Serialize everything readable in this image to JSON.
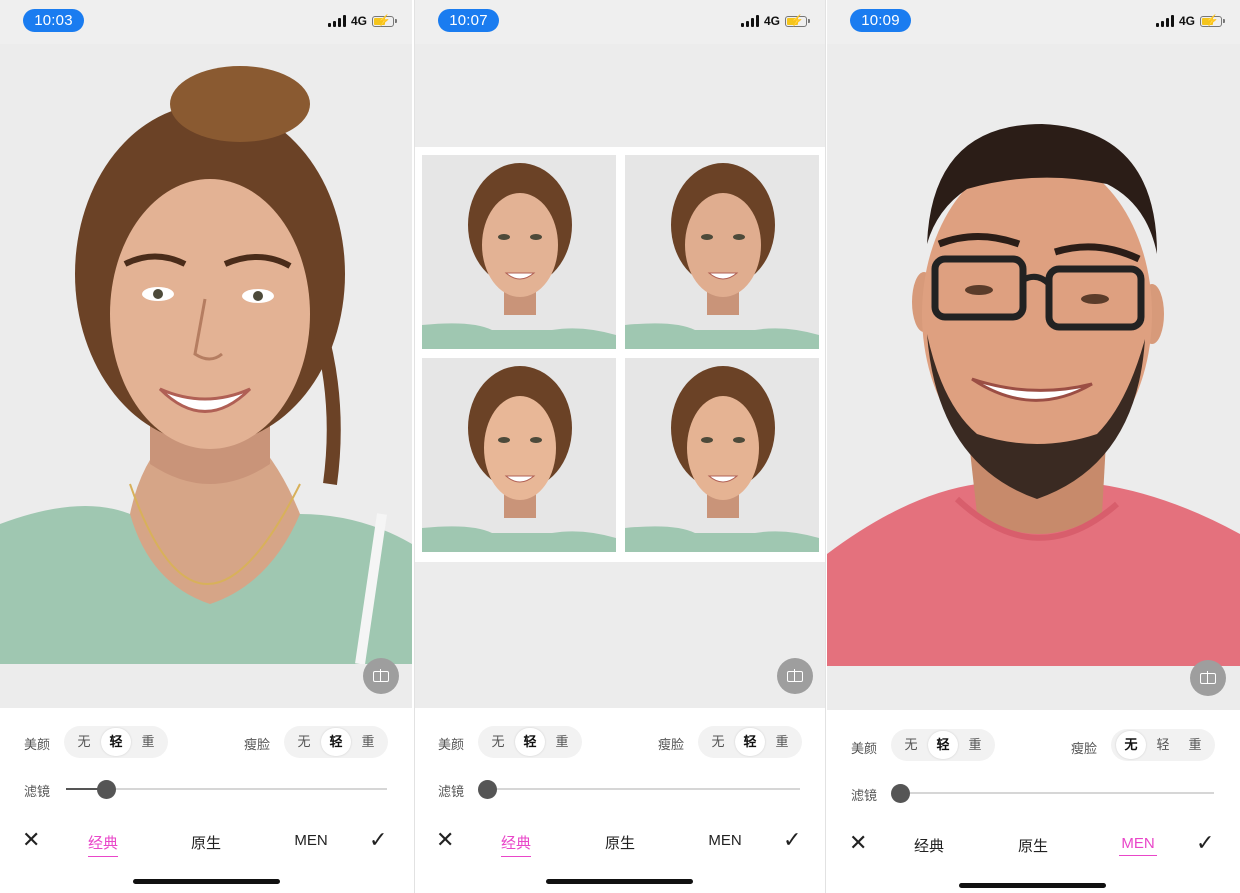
{
  "screens": [
    {
      "status": {
        "time": "10:03",
        "network": "4G"
      },
      "controls": {
        "beauty_label": "美颜",
        "beauty_options": [
          "无",
          "轻",
          "重"
        ],
        "beauty_selected": "轻",
        "slim_label": "瘦脸",
        "slim_options": [
          "无",
          "轻",
          "重"
        ],
        "slim_selected": "轻",
        "filter_label": "滤镜",
        "filter_level": 0.14
      },
      "tabs": [
        "经典",
        "原生",
        "MEN"
      ],
      "selected_tab": "经典"
    },
    {
      "status": {
        "time": "10:07",
        "network": "4G"
      },
      "controls": {
        "beauty_label": "美颜",
        "beauty_options": [
          "无",
          "轻",
          "重"
        ],
        "beauty_selected": "轻",
        "slim_label": "瘦脸",
        "slim_options": [
          "无",
          "轻",
          "重"
        ],
        "slim_selected": "轻",
        "filter_label": "滤镜",
        "filter_level": 0.0
      },
      "tabs": [
        "经典",
        "原生",
        "MEN"
      ],
      "selected_tab": "经典"
    },
    {
      "status": {
        "time": "10:09",
        "network": "4G"
      },
      "controls": {
        "beauty_label": "美颜",
        "beauty_options": [
          "无",
          "轻",
          "重"
        ],
        "beauty_selected": "轻",
        "slim_label": "瘦脸",
        "slim_options": [
          "无",
          "轻",
          "重"
        ],
        "slim_selected": "无",
        "filter_label": "滤镜",
        "filter_level": 0.0
      },
      "tabs": [
        "经典",
        "原生",
        "MEN"
      ],
      "selected_tab": "MEN"
    }
  ],
  "icons": {
    "close": "close-icon",
    "confirm": "check-icon",
    "compare": "compare-icon",
    "signal": "signal-icon",
    "battery": "battery-charging-icon"
  },
  "colors": {
    "time_pill": "#1a7cf0",
    "accent_tab": "#e946c9",
    "battery_fill": "#f4c51c"
  }
}
